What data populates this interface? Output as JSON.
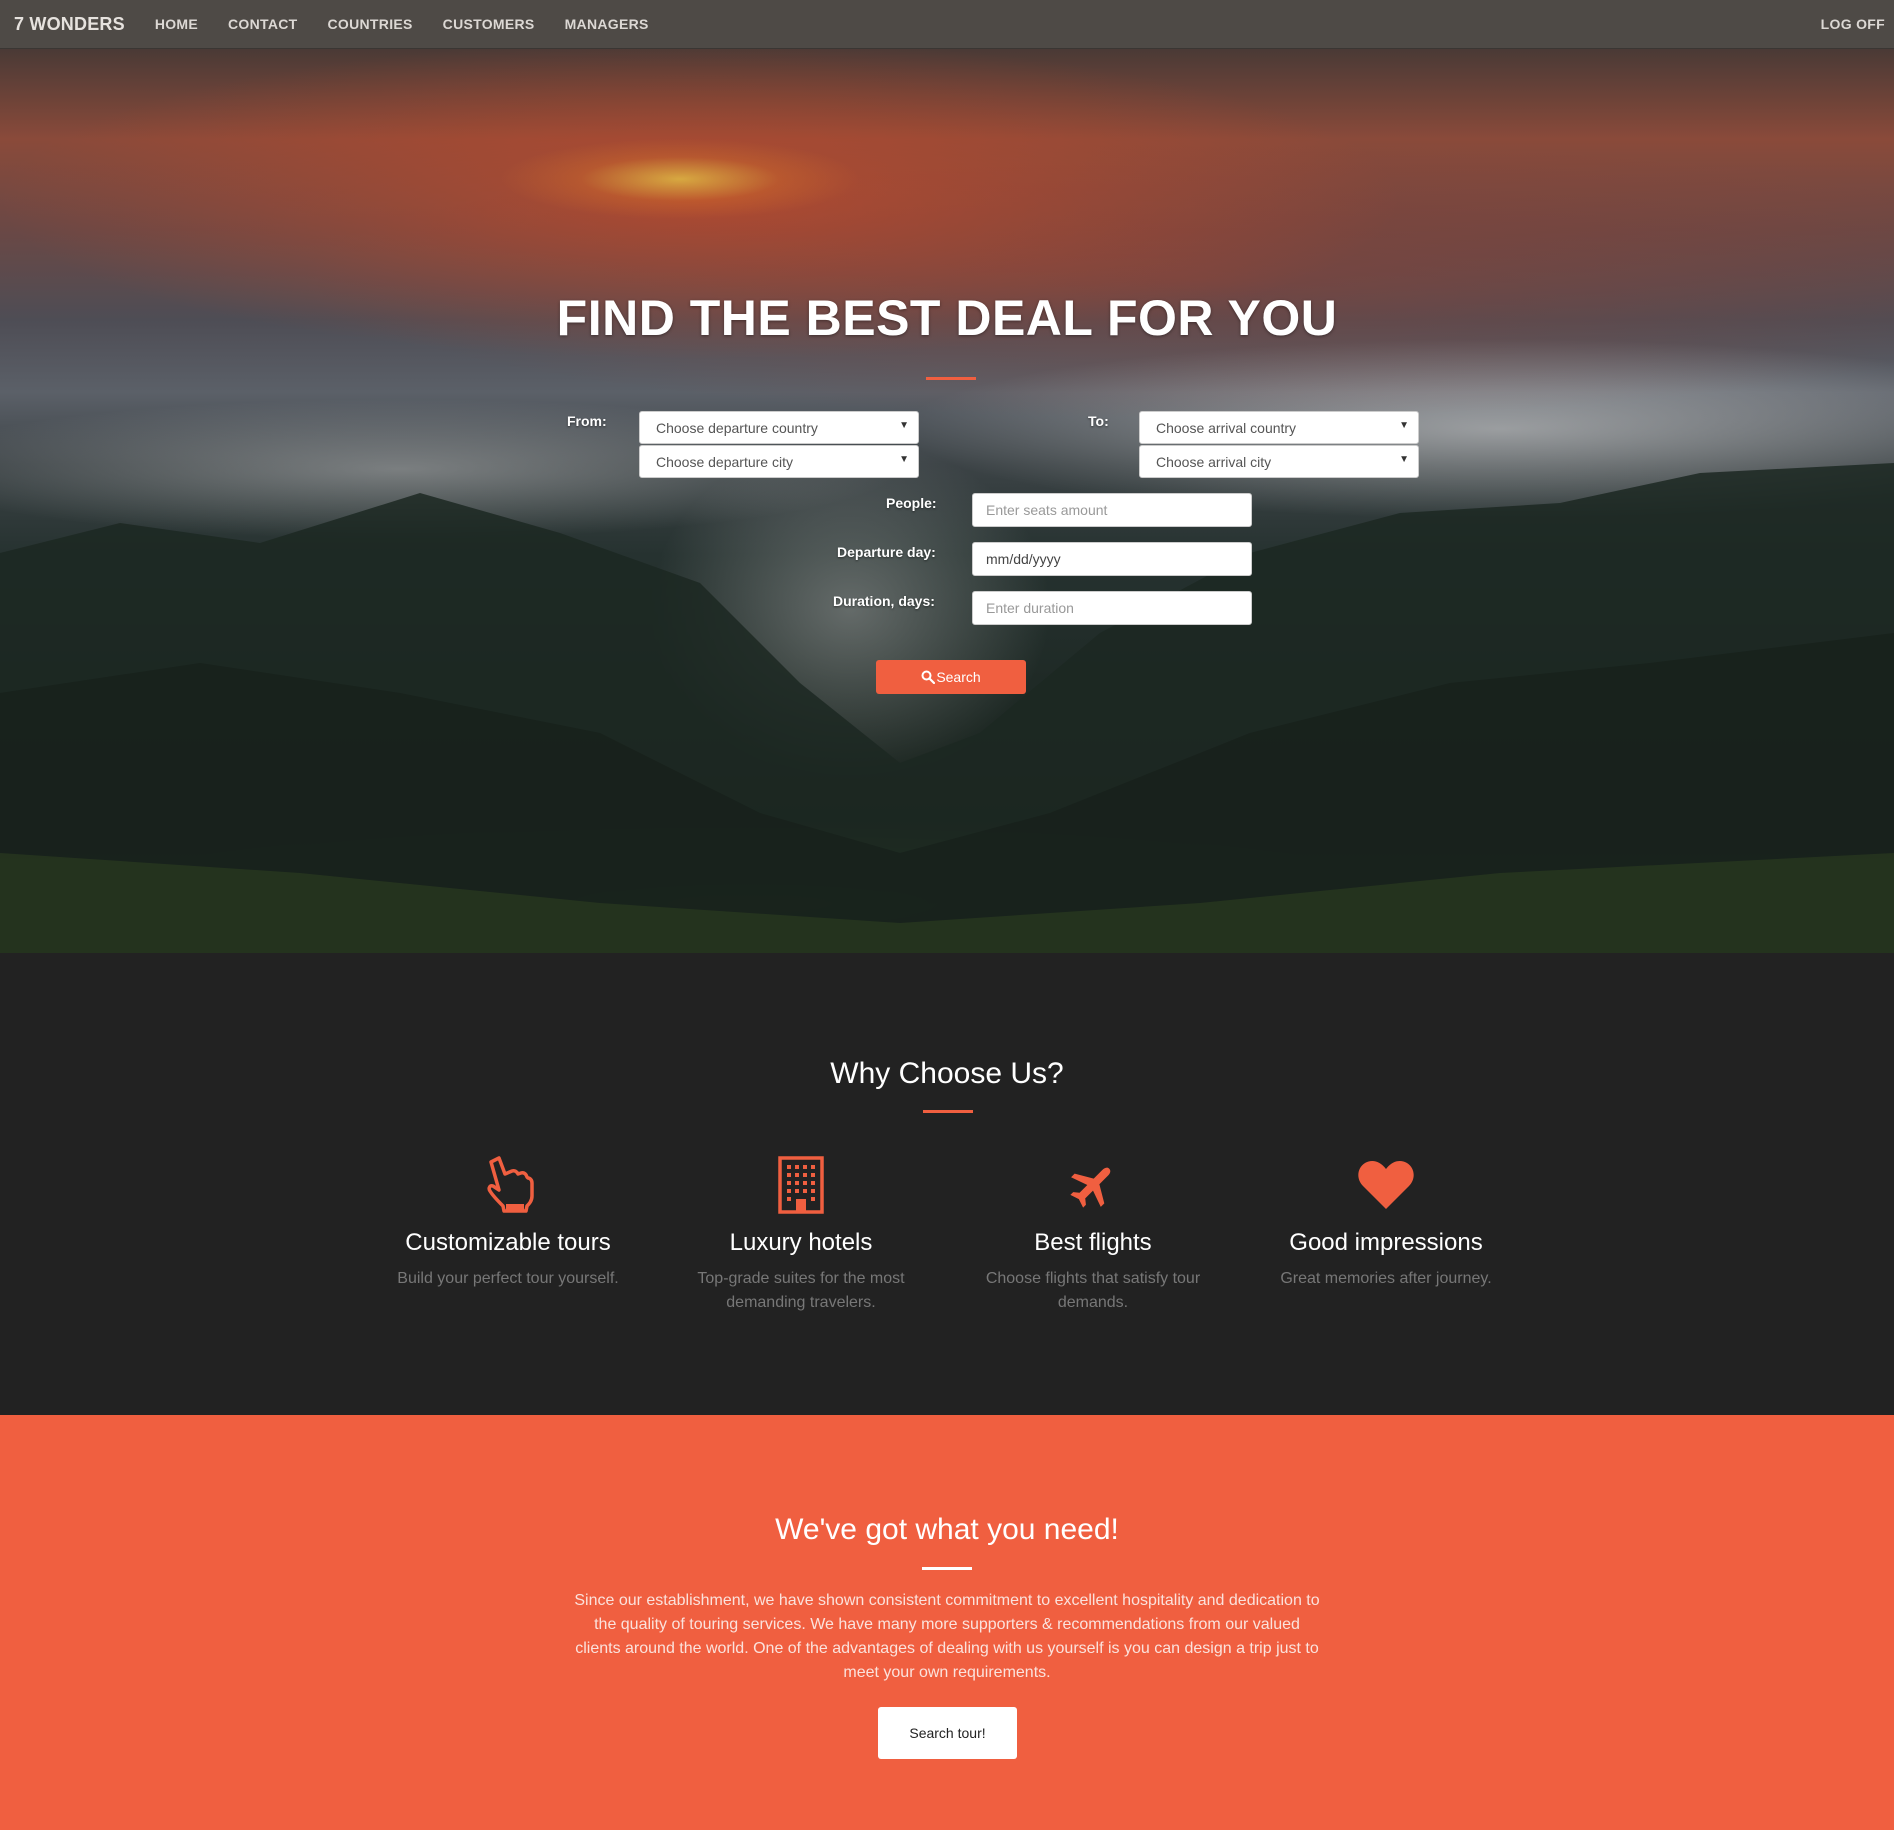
{
  "nav": {
    "brand": "7 WONDERS",
    "links": [
      "HOME",
      "CONTACT",
      "COUNTRIES",
      "CUSTOMERS",
      "MANAGERS"
    ],
    "logoff": "LOG OFF"
  },
  "hero": {
    "title": "FIND THE BEST DEAL FOR YOU",
    "from_label": "From:",
    "to_label": "To:",
    "departure_country": "Choose departure country",
    "departure_city": "Choose departure city",
    "arrival_country": "Choose arrival country",
    "arrival_city": "Choose arrival city",
    "people_label": "People:",
    "people_placeholder": "Enter seats amount",
    "departure_day_label": "Departure day:",
    "departure_day_value": "mm/dd/yyyy",
    "duration_label": "Duration, days:",
    "duration_placeholder": "Enter duration",
    "search_label": "Search",
    "accent_color": "#f05f40"
  },
  "why": {
    "title": "Why Choose Us?",
    "features": [
      {
        "icon": "hand-pointer-icon",
        "title": "Customizable tours",
        "text": "Build your perfect tour yourself."
      },
      {
        "icon": "building-icon",
        "title": "Luxury hotels",
        "text": "Top-grade suites for the most demanding travelers."
      },
      {
        "icon": "plane-icon",
        "title": "Best flights",
        "text": "Choose flights that satisfy tour demands."
      },
      {
        "icon": "heart-icon",
        "title": "Good impressions",
        "text": "Great memories after journey."
      }
    ]
  },
  "need": {
    "title": "We've got what you need!",
    "text": "Since our establishment, we have shown consistent commitment to excellent hospitality and dedication to the quality of touring services. We have many more supporters & recommendations from our valued clients around the world. One of the advantages of dealing with us yourself is you can design a trip just to meet your own requirements.",
    "button": "Search tour!"
  }
}
